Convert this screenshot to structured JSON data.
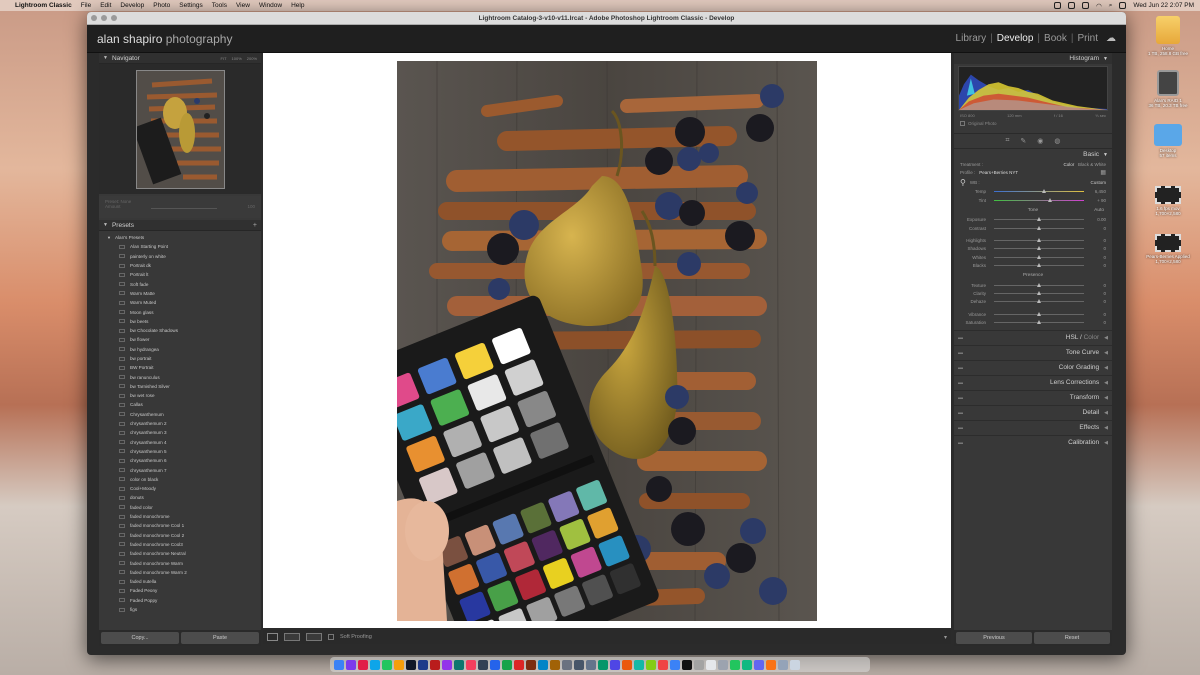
{
  "menubar": {
    "app": "Lightroom Classic",
    "items": [
      "File",
      "Edit",
      "Develop",
      "Photo",
      "Settings",
      "Tools",
      "View",
      "Window",
      "Help"
    ],
    "clock": "Wed Jun 22  2:07 PM"
  },
  "desktop": {
    "icons": [
      {
        "label": "Home",
        "sub": "1 TB, 258.8 GB free",
        "icon": "drive-icon"
      },
      {
        "label": "Alan's RAID 1",
        "sub": "36 TB, 20.3 TB free",
        "icon": "raid-drive-icon"
      },
      {
        "label": "Desktop",
        "sub": "57 items",
        "icon": "folder-icon"
      },
      {
        "label": "1.6 fps mov",
        "sub": "1,700×2,580",
        "icon": "film-icon"
      },
      {
        "label": "Pears-Berries Applied",
        "sub": "1,700×2,580",
        "icon": "film-icon"
      }
    ]
  },
  "window": {
    "title": "Lightroom Catalog-3-v10-v11.lrcat - Adobe Photoshop Lightroom Classic - Develop",
    "identity_main": "alan shapiro",
    "identity_light": " photography",
    "modules": [
      "Library",
      "Develop",
      "Book",
      "Print"
    ],
    "active_module": "Develop"
  },
  "navigator": {
    "title": "Navigator",
    "zoom_options": [
      "FIT",
      "100%",
      "200%"
    ]
  },
  "snapshot": {
    "preset_label": "Preset: None",
    "amount_label": "Amount",
    "amount_value": "100"
  },
  "presets": {
    "title": "Presets",
    "group": "Alan's Presets",
    "items": [
      "Alan Starting Point",
      "painterly on white",
      "Portrait dk",
      "Portrait lt",
      "Soft fade",
      "Warm Matte",
      "Warm Muted",
      "Moon glass",
      "bw beets",
      "bw Chocolate Shadows",
      "bw flower",
      "bw hydrangea",
      "bw portrait",
      "BW Portrait",
      "bw ranunculus",
      "bw Tarnished Silver",
      "bw wet rose",
      "Callas",
      "Chrysanthemum",
      "chrysanthemum 2",
      "chrysanthemum 3",
      "chrysanthemum 4",
      "chrysanthemum 5",
      "chrysanthemum 6",
      "chrysanthemum 7",
      "color on black",
      "Cool+Moody",
      "donuts",
      "faded color",
      "faded monochrome",
      "faded monochrome Cool 1",
      "faded monochrome Cool 2",
      "faded monochrome Cool3",
      "faded monochrome Neutral",
      "faded monochrome Warm",
      "faded monochrome Warm 2",
      "faded nutella",
      "Faded Peony",
      "Faded Poppy",
      "figs"
    ]
  },
  "left_buttons": {
    "copy": "Copy...",
    "paste": "Paste"
  },
  "toolbar": {
    "soft_proofing": "Soft Proofing"
  },
  "histogram": {
    "title": "Histogram",
    "iso": "ISO 800",
    "focal": "120 mm",
    "aperture": "f / 16",
    "shutter": "⅓ sec",
    "original_photo": "Original Photo"
  },
  "basic": {
    "title": "Basic",
    "treatment_label": "Treatment :",
    "treatment_color": "Color",
    "treatment_bw": "Black & White",
    "profile_label": "Profile :",
    "profile_value": "Pears+Berries NYT",
    "wb_label": "WB :",
    "wb_value": "Custom",
    "temp_label": "Temp",
    "temp_value": "6,450",
    "temp_pos": 0.55,
    "tint_label": "Tint",
    "tint_value": "+ 90",
    "tint_pos": 0.62,
    "tone_label": "Tone",
    "auto_label": "Auto",
    "presence_label": "Presence",
    "tone_rows": [
      {
        "label": "Exposure",
        "value": "0.00",
        "pos": 0.5
      },
      {
        "label": "Contrast",
        "value": "0",
        "pos": 0.5
      }
    ],
    "tone_rows2": [
      {
        "label": "Highlights",
        "value": "0",
        "pos": 0.5
      },
      {
        "label": "Shadows",
        "value": "0",
        "pos": 0.5
      },
      {
        "label": "Whites",
        "value": "0",
        "pos": 0.5
      },
      {
        "label": "Blacks",
        "value": "0",
        "pos": 0.5
      }
    ],
    "presence_rows": [
      {
        "label": "Texture",
        "value": "0",
        "pos": 0.5
      },
      {
        "label": "Clarity",
        "value": "0",
        "pos": 0.5
      },
      {
        "label": "Dehaze",
        "value": "0",
        "pos": 0.5
      }
    ],
    "presence_rows2": [
      {
        "label": "Vibrance",
        "value": "0",
        "pos": 0.5
      },
      {
        "label": "Saturation",
        "value": "0",
        "pos": 0.5
      }
    ]
  },
  "hsl": {
    "hsl": "HSL",
    "sep": " / ",
    "color": "Color"
  },
  "sections": [
    "Tone Curve",
    "Color Grading",
    "Lens Corrections",
    "Transform",
    "Detail",
    "Effects",
    "Calibration"
  ],
  "right_buttons": {
    "previous": "Previous",
    "reset": "Reset"
  },
  "dock_colors": [
    "#3b82f6",
    "#7c3aed",
    "#e11d48",
    "#0ea5e9",
    "#22c55e",
    "#f59e0b",
    "#111827",
    "#1e3a8a",
    "#b91c1c",
    "#9333ea",
    "#0f766e",
    "#f43f5e",
    "#334155",
    "#2563eb",
    "#16a34a",
    "#dc2626",
    "#7c2d12",
    "#0284c7",
    "#a16207",
    "#6b7280",
    "#475569",
    "#64748b",
    "#059669",
    "#4f46e5",
    "#ea580c",
    "#14b8a6",
    "#84cc16",
    "#ef4444",
    "#3b82f6",
    "#111111",
    "#a3a3a3",
    "#e5e7eb",
    "#9ca3af",
    "#22c55e",
    "#10b981",
    "#6366f1",
    "#f97316",
    "#94a3b8",
    "#cbd5e1"
  ]
}
